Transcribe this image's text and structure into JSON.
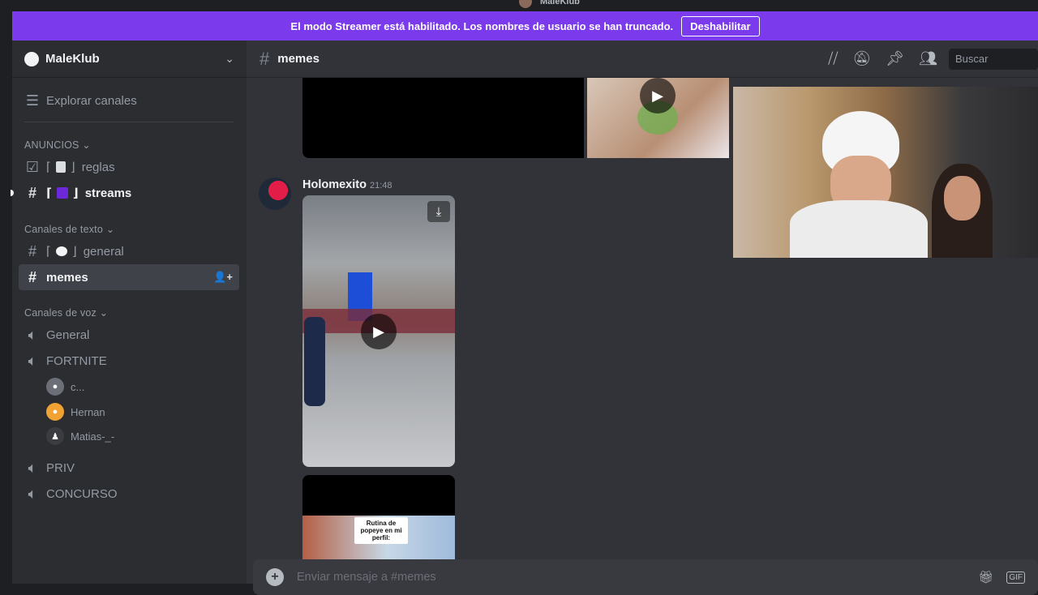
{
  "window": {
    "title": "MaleKlub"
  },
  "banner": {
    "text": "El modo Streamer está habilitado. Los nombres de usuario se han truncado.",
    "button": "Deshabilitar"
  },
  "server": {
    "name": "MaleKlub"
  },
  "sidebar": {
    "explore": "Explorar canales",
    "categories": {
      "announcements": "ANUNCIOS",
      "text": "Canales de texto",
      "voice": "Canales de voz"
    },
    "channels": {
      "reglas": "reglas",
      "streams": "streams",
      "general": "general",
      "memes": "memes"
    },
    "voice_channels": {
      "general": "General",
      "fortnite": "FORTNITE",
      "priv": "PRIV",
      "concurso": "CONCURSO"
    },
    "voice_users": [
      "c...",
      "Hernan",
      "Matias-_-"
    ]
  },
  "channel_header": {
    "name": "memes",
    "search_placeholder": "Buscar"
  },
  "message": {
    "author": "Holomexito",
    "time": "21:48",
    "overlay_caption": "Rutina de popeye en mi perfil:"
  },
  "composer": {
    "placeholder": "Enviar mensaje a #memes"
  },
  "colors": {
    "banner": "#7c3aed",
    "sidebar": "#2b2d31",
    "main": "#313338",
    "active_channel": "#404249"
  }
}
